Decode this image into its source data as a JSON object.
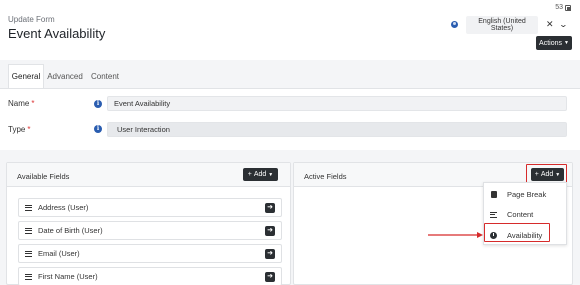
{
  "header": {
    "subtitle": "Update Form",
    "title": "Event Availability",
    "counter": "53",
    "language": "English (United States)",
    "actions_label": "Actions"
  },
  "tabs": [
    {
      "label": "General",
      "active": true
    },
    {
      "label": "Advanced",
      "active": false
    },
    {
      "label": "Content",
      "active": false
    }
  ],
  "form": {
    "name_label": "Name",
    "name_value": "Event Availability",
    "type_label": "Type",
    "type_value": "User Interaction",
    "required_mark": "*"
  },
  "available_fields": {
    "title": "Available Fields",
    "add_label": "Add",
    "items": [
      "Address (User)",
      "Date of Birth (User)",
      "Email (User)",
      "First Name (User)"
    ]
  },
  "active_fields": {
    "title": "Active Fields",
    "add_label": "Add",
    "dropdown": [
      {
        "label": "Page Break",
        "icon": "page-break-icon"
      },
      {
        "label": "Content",
        "icon": "content-icon"
      },
      {
        "label": "Availability",
        "icon": "clock-icon"
      }
    ]
  },
  "colors": {
    "dark_button": "#2b2f33",
    "highlight": "#d62b2b",
    "info_icon": "#2a5db0",
    "required": "#d33333"
  }
}
